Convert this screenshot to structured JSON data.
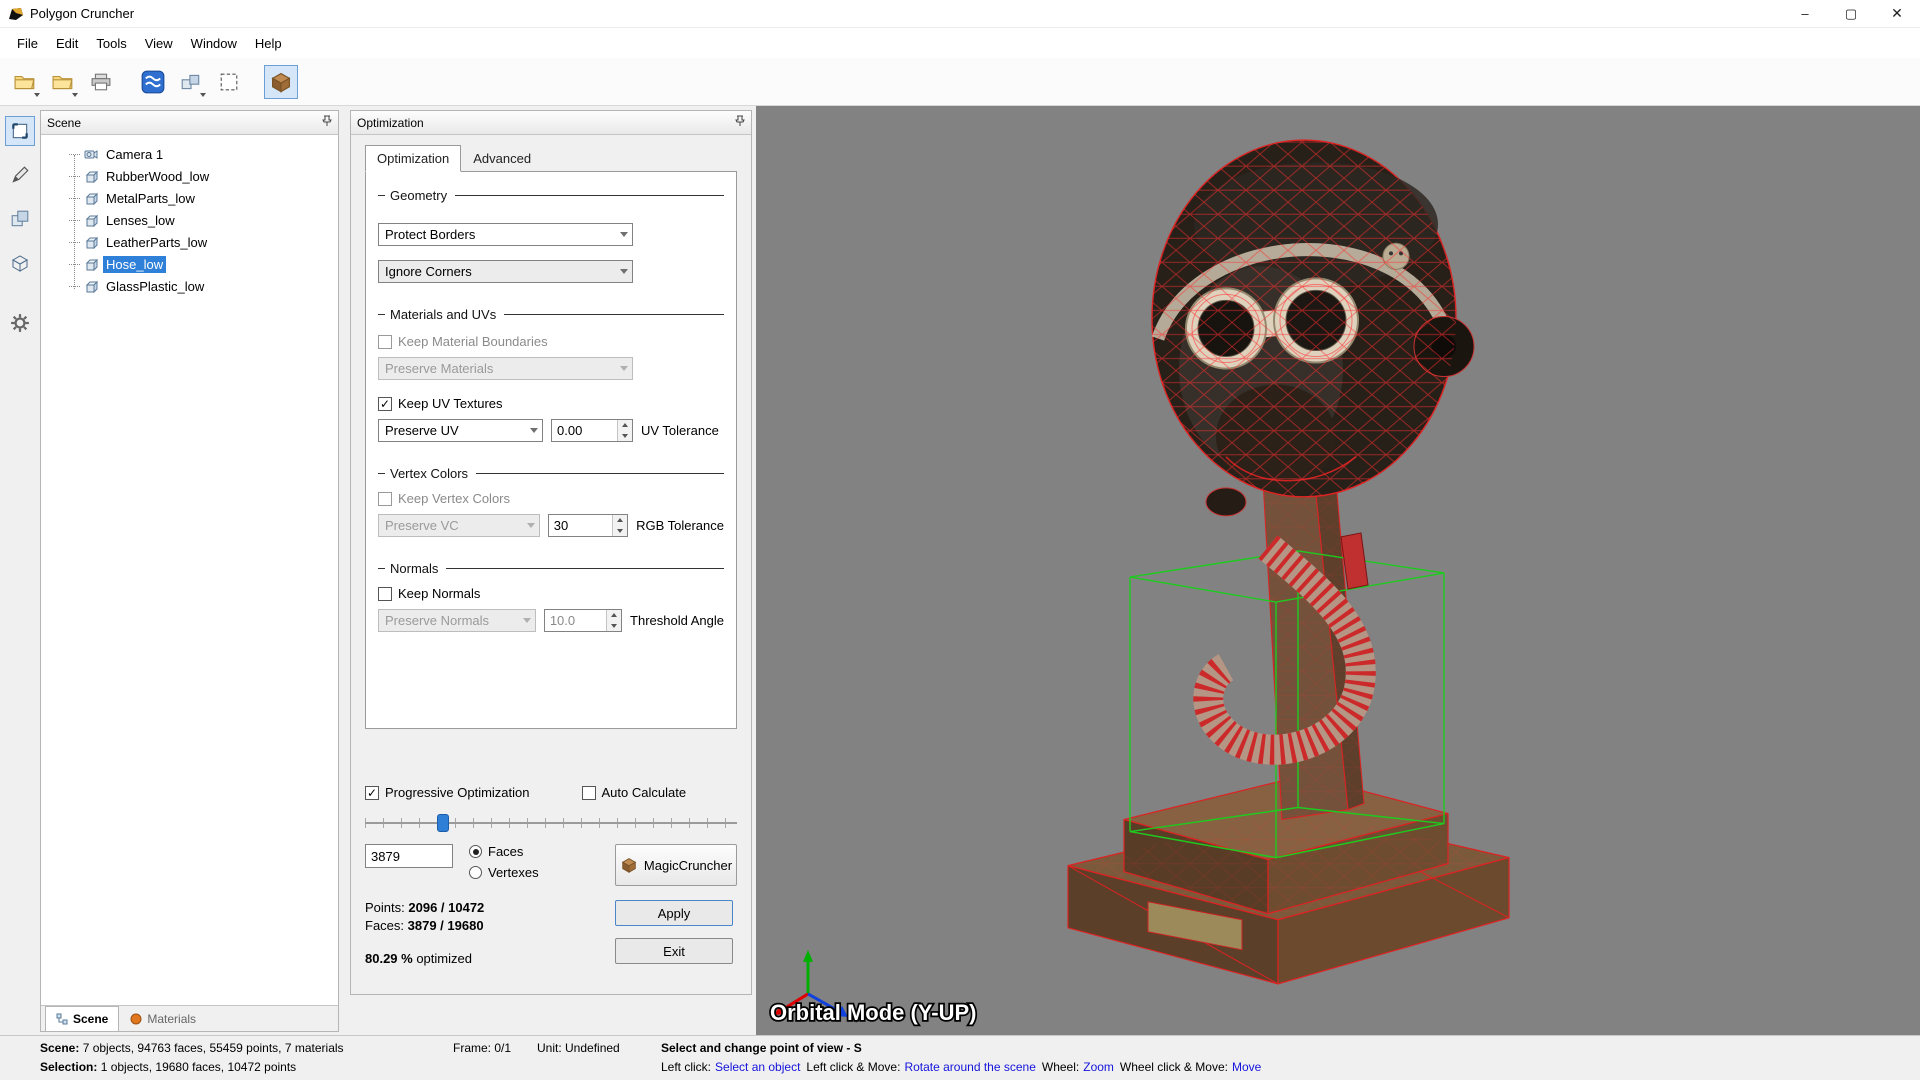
{
  "window": {
    "title": "Polygon Cruncher",
    "minimize_glyph": "–",
    "maximize_glyph": "▢",
    "close_glyph": "✕"
  },
  "menubar": {
    "items": [
      "File",
      "Edit",
      "Tools",
      "View",
      "Window",
      "Help"
    ]
  },
  "toolbar": {
    "icons": [
      "open-scene",
      "open-file",
      "print",
      "textures",
      "clone-group",
      "selection-zone",
      "polygon-cruncher-optimize"
    ]
  },
  "left_toolbar": {
    "icons": [
      "selection-mode",
      "paint-mode",
      "duplicate-object",
      "bounding-box",
      "settings-gear"
    ]
  },
  "scene_panel": {
    "title": "Scene",
    "items": [
      {
        "label": "Camera 1",
        "icon": "camera",
        "selected": false
      },
      {
        "label": "RubberWood_low",
        "icon": "mesh",
        "selected": false
      },
      {
        "label": "MetalParts_low",
        "icon": "mesh",
        "selected": false
      },
      {
        "label": "Lenses_low",
        "icon": "mesh",
        "selected": false
      },
      {
        "label": "LeatherParts_low",
        "icon": "mesh",
        "selected": false
      },
      {
        "label": "Hose_low",
        "icon": "mesh",
        "selected": true
      },
      {
        "label": "GlassPlastic_low",
        "icon": "mesh",
        "selected": false
      }
    ],
    "tabs": [
      {
        "label": "Scene",
        "active": true
      },
      {
        "label": "Materials",
        "active": false
      }
    ]
  },
  "optimization_panel": {
    "title": "Optimization",
    "tabs": [
      {
        "label": "Optimization",
        "active": true
      },
      {
        "label": "Advanced",
        "active": false
      }
    ],
    "geometry": {
      "section": "Geometry",
      "protect_borders": "Protect Borders",
      "ignore_corners": "Ignore Corners"
    },
    "materials_uvs": {
      "section": "Materials and UVs",
      "keep_material_boundaries": "Keep Material Boundaries",
      "preserve_materials": "Preserve Materials",
      "keep_uv_textures": "Keep UV Textures",
      "preserve_uv": "Preserve UV",
      "uv_tolerance_value": "0.00",
      "uv_tolerance_label": "UV Tolerance"
    },
    "vertex_colors": {
      "section": "Vertex Colors",
      "keep_vertex_colors": "Keep Vertex Colors",
      "preserve_vc": "Preserve VC",
      "rgb_tolerance_value": "30",
      "rgb_tolerance_label": "RGB Tolerance"
    },
    "normals": {
      "section": "Normals",
      "keep_normals": "Keep Normals",
      "preserve_normals": "Preserve Normals",
      "threshold_value": "10.0",
      "threshold_label": "Threshold Angle"
    },
    "progressive_optimization": "Progressive Optimization",
    "auto_calculate": "Auto Calculate",
    "slider_pct": 21,
    "count_value": "3879",
    "faces_radio": "Faces",
    "vertexes_radio": "Vertexes",
    "magic_button": "MagicCruncher",
    "points_label": "Points:",
    "points_value": "2096 / 10472",
    "faces_label": "Faces:",
    "faces_value": "3879 / 19680",
    "apply_button": "Apply",
    "exit_button": "Exit",
    "optimized_value": "80.29 %",
    "optimized_label": "optimized"
  },
  "viewport": {
    "mode_label": "Orbital Mode (Y-UP)"
  },
  "statusbar": {
    "scene_label": "Scene:",
    "scene_value": "7 objects,  94763 faces,  55459 points,  7 materials",
    "selection_label": "Selection:",
    "selection_value": "1 objects,  19680 faces,  10472 points",
    "frame": "Frame: 0/1",
    "unit": "Unit: Undefined",
    "hint_title": "Select and change point of view - S",
    "hints": [
      {
        "label": "Left click:",
        "value": "Select an object"
      },
      {
        "label": "Left click & Move:",
        "value": "Rotate around the scene"
      },
      {
        "label": "Wheel:",
        "value": "Zoom"
      },
      {
        "label": "Wheel click & Move:",
        "value": "Move"
      }
    ]
  },
  "colors": {
    "selection_bg": "#2f80d9",
    "hint_blue": "#1414dc",
    "viewport_bg": "#828282",
    "wireframe_red": "#dd2222",
    "box_green": "#1ecb1e",
    "slider_blue": "#2f7fd6"
  }
}
